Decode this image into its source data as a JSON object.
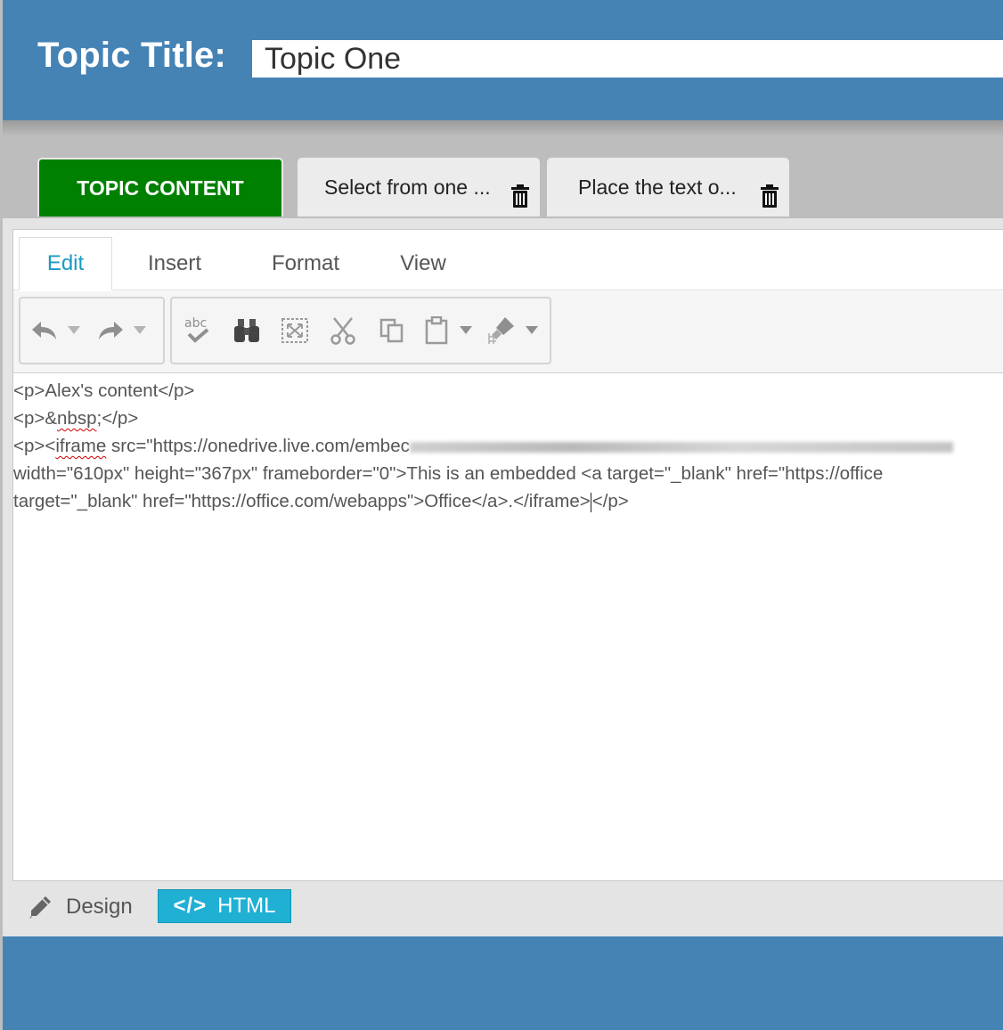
{
  "header": {
    "title_label": "Topic Title:",
    "title_value": "Topic One"
  },
  "topic_tabs": {
    "content": "TOPIC CONTENT",
    "tab2": "Select from one ...",
    "tab3": "Place the text o..."
  },
  "editor": {
    "menu": [
      "Edit",
      "Insert",
      "Format",
      "View"
    ],
    "toolbar_icons": [
      "undo-icon",
      "redo-icon",
      "spellcheck-icon",
      "find-icon",
      "select-all-icon",
      "cut-icon",
      "copy-icon",
      "paste-icon",
      "format-painter-icon"
    ],
    "code": {
      "l1": "<p>Alex's content</p>",
      "l2a": "<p>&",
      "l2b": "nbsp",
      "l2c": ";</p>",
      "l3a": "<p><",
      "l3b": "iframe",
      "l3c": " src=\"https://onedrive.live.com/embec",
      "l4": "width=\"610px\" height=\"367px\" frameborder=\"0\">This is an embedded <a target=\"_blank\" href=\"https://office",
      "l5a": "target=\"_blank\" href=\"https://office.com/webapps\">Office</a>.</iframe>",
      "l5b": "</p>"
    },
    "modes": {
      "design": "Design",
      "html_glyph": "</>",
      "html": "HTML"
    }
  },
  "colors": {
    "header_bg": "#4683b5",
    "active_tab": "#008000",
    "accent": "#1fb0d4",
    "menu_active": "#1a9ac2"
  }
}
